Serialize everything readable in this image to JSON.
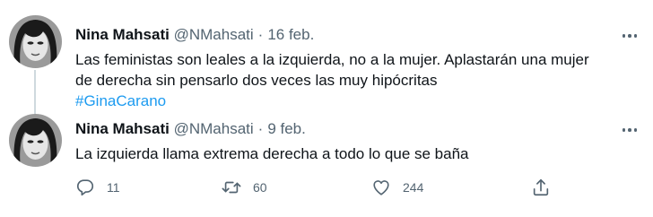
{
  "tweets": [
    {
      "author_name": "Nina Mahsati",
      "handle": "@NMahsati",
      "separator": "·",
      "date": "16 feb.",
      "text_line1": "Las feministas son leales a la izquierda, no a la mujer. Aplastarán una mujer",
      "text_line2": "de derecha sin pensarlo dos veces las muy hipócritas",
      "hashtag": "#GinaCarano"
    },
    {
      "author_name": "Nina Mahsati",
      "handle": "@NMahsati",
      "separator": "·",
      "date": "9 feb.",
      "text_line1": "La izquierda llama extrema derecha a todo lo que se baña",
      "actions": {
        "reply_count": "11",
        "retweet_count": "60",
        "like_count": "244"
      }
    }
  ],
  "icons": {
    "avatar": "avatar-photo",
    "more": "more-icon",
    "reply": "reply-icon",
    "retweet": "retweet-icon",
    "like": "heart-icon",
    "share": "share-icon"
  },
  "colors": {
    "text": "#0f1419",
    "secondary": "#536471",
    "link": "#1d9bf0",
    "thread_line": "#cfd9de"
  }
}
